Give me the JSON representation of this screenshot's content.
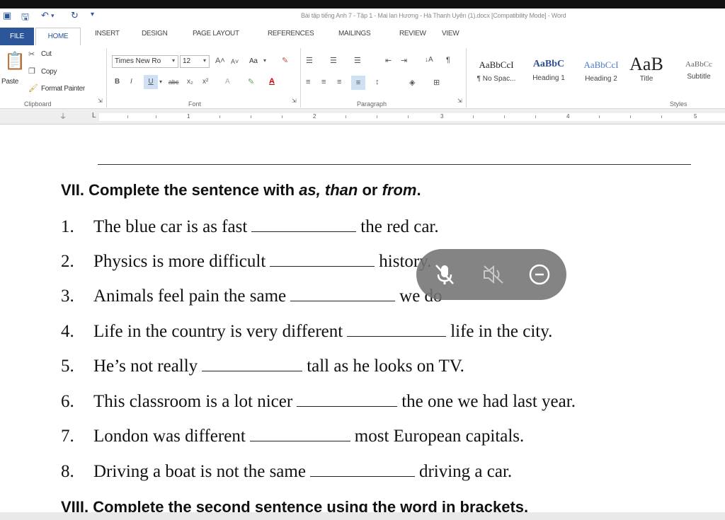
{
  "titlebar": {
    "title": "Bài tập tiếng Anh 7 - Tập 1 - Mai lan Hương - Hà Thanh Uyên (1).docx [Compatibility Mode] - Word"
  },
  "tabs": [
    {
      "label": "FILE"
    },
    {
      "label": "HOME"
    },
    {
      "label": "INSERT"
    },
    {
      "label": "DESIGN"
    },
    {
      "label": "PAGE LAYOUT"
    },
    {
      "label": "REFERENCES"
    },
    {
      "label": "MAILINGS"
    },
    {
      "label": "REVIEW"
    },
    {
      "label": "VIEW"
    }
  ],
  "clipboard": {
    "paste": "Paste",
    "cut": "Cut",
    "copy": "Copy",
    "format_painter": "Format Painter",
    "group": "Clipboard"
  },
  "font": {
    "name": "Times New Ro",
    "size": "12",
    "case": "Aa",
    "group": "Font"
  },
  "paragraph": {
    "group": "Paragraph"
  },
  "styles": {
    "items": [
      {
        "preview": "AaBbCcI",
        "name": "¶ No Spac..."
      },
      {
        "preview": "AaBbC",
        "name": "Heading 1"
      },
      {
        "preview": "AaBbCcI",
        "name": "Heading 2"
      },
      {
        "preview": "AaB",
        "name": "Title"
      },
      {
        "preview": "AaBbCc",
        "name": "Subtitle"
      }
    ],
    "group": "Styles"
  },
  "ruler": {
    "numbers": [
      "1",
      "2",
      "3",
      "4",
      "5"
    ]
  },
  "document": {
    "section7": {
      "prefix": "VII. Complete the sentence with ",
      "w1": "as",
      "sep1": ", ",
      "w2": "than",
      "sep2": " or ",
      "w3": "from",
      "end": "."
    },
    "items": [
      {
        "num": "1.",
        "before": "The blue car is as fast",
        "after": "the red car."
      },
      {
        "num": "2.",
        "before": "Physics is more difficult",
        "after": "history."
      },
      {
        "num": "3.",
        "before": "Animals feel pain the same",
        "after": "we do"
      },
      {
        "num": "4.",
        "before": "Life in the country is very different",
        "after": "life in the city."
      },
      {
        "num": "5.",
        "before": "He’s not really",
        "after": "tall as he looks on TV."
      },
      {
        "num": "6.",
        "before": "This classroom is a lot nicer",
        "after": "the one we had last year."
      },
      {
        "num": "7.",
        "before": "London was different",
        "after": "most European capitals."
      },
      {
        "num": "8.",
        "before": "Driving a boat is not the same",
        "after": "driving a car."
      }
    ],
    "section8": "VIII. Complete the second sentence using the word in brackets."
  },
  "colors": {
    "accent": "#2b579a",
    "overlay": "#737373"
  }
}
